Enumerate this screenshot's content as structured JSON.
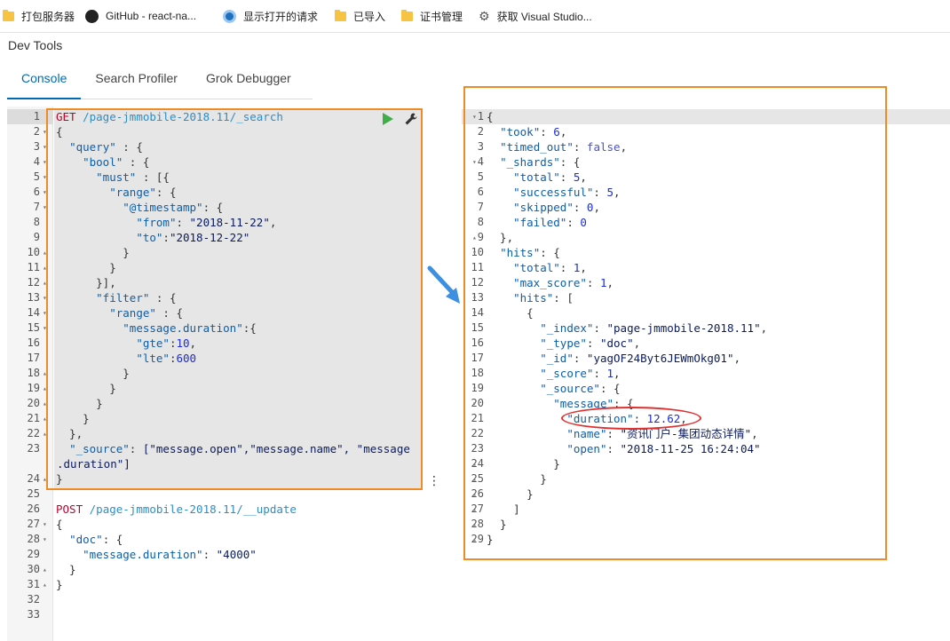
{
  "bookmarks": [
    {
      "label": "打包服务器",
      "icon": "folder-icon"
    },
    {
      "label": "GitHub - react-na...",
      "icon": "github-icon"
    },
    {
      "label": "显示打开的请求",
      "icon": "globe-icon"
    },
    {
      "label": "已导入",
      "icon": "folder-icon"
    },
    {
      "label": "证书管理",
      "icon": "folder-icon"
    },
    {
      "label": "获取 Visual Studio...",
      "icon": "gear-icon"
    }
  ],
  "app": {
    "title": "Dev Tools"
  },
  "tabs": [
    {
      "label": "Console",
      "active": true
    },
    {
      "label": "Search Profiler",
      "active": false
    },
    {
      "label": "Grok Debugger",
      "active": false
    }
  ],
  "request": {
    "method": "GET",
    "url": "/page-jmmobile-2018.11/_search",
    "query_key": "\"query\"",
    "bool_key": "\"bool\"",
    "must_key": "\"must\"",
    "range_key": "\"range\"",
    "timestamp_key": "\"@timestamp\"",
    "from_key": "\"from\"",
    "from_value": "\"2018-11-22\"",
    "to_key": "\"to\"",
    "to_value": "\"2018-12-22\"",
    "filter_key": "\"filter\"",
    "duration_key": "\"message.duration\"",
    "gte_key": "\"gte\"",
    "gte_value": "10",
    "lte_key": "\"lte\"",
    "lte_value": "600",
    "source_key": "\"_source\"",
    "source_line1": "[\"message.open\",\"message.name\", \"message",
    "source_line2": ".duration\"]"
  },
  "update_request": {
    "method": "POST",
    "url": "/page-jmmobile-2018.11/__update",
    "doc_key": "\"doc\"",
    "duration_key": "\"message.duration\"",
    "duration_value": "\"4000\""
  },
  "response": {
    "took_key": "\"took\"",
    "took": "6",
    "timed_out_key": "\"timed_out\"",
    "timed_out": "false",
    "shards_key": "\"_shards\"",
    "total_key": "\"total\"",
    "shards_total": "5",
    "successful_key": "\"successful\"",
    "successful": "5",
    "skipped_key": "\"skipped\"",
    "skipped": "0",
    "failed_key": "\"failed\"",
    "failed": "0",
    "hits_key": "\"hits\"",
    "hits_total": "1",
    "max_score_key": "\"max_score\"",
    "max_score": "1",
    "index_key": "\"_index\"",
    "index": "\"page-jmmobile-2018.11\"",
    "type_key": "\"_type\"",
    "type": "\"doc\"",
    "id_key": "\"_id\"",
    "id": "\"yagOF24Byt6JEWmOkg01\"",
    "score_key": "\"_score\"",
    "score": "1",
    "source_key": "\"_source\"",
    "message_key": "\"message\"",
    "duration_key": "\"duration\"",
    "duration": "12.62",
    "name_key": "\"name\"",
    "name": "\"资讯门户-集团动态详情\"",
    "open_key": "\"open\"",
    "open": "\"2018-11-25 16:24:04\""
  },
  "colors": {
    "highlight": "#f08a24",
    "annotation": "#e03131",
    "arrow": "#3d8fe0",
    "accent": "#006bb4"
  }
}
